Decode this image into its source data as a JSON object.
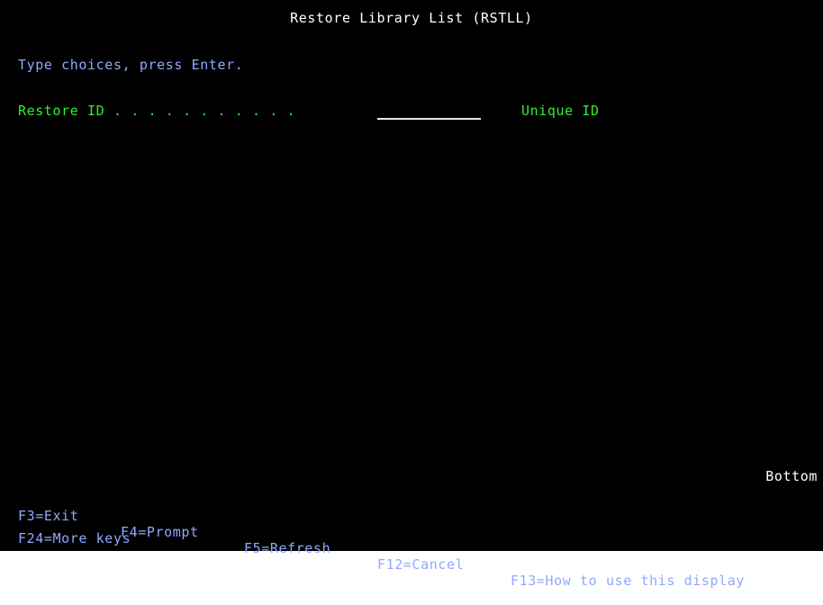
{
  "screen": {
    "title": "Restore Library List (RSTLL)",
    "instructions": "Type choices, press Enter.",
    "bottom_marker": "Bottom"
  },
  "fields": [
    {
      "label": "Restore ID . . . . . . . . . . .",
      "value": "",
      "help": "Unique ID"
    }
  ],
  "function_keys": {
    "row1": [
      "F3=Exit",
      "F4=Prompt",
      "F5=Refresh",
      "F12=Cancel",
      "F13=How to use this display"
    ],
    "row2": [
      "F24=More keys"
    ]
  },
  "colors": {
    "background": "#000000",
    "title": "#ffffff",
    "instructions": "#8fa8ff",
    "field_label": "#33ee33",
    "function_keys": "#8fa8ff"
  }
}
